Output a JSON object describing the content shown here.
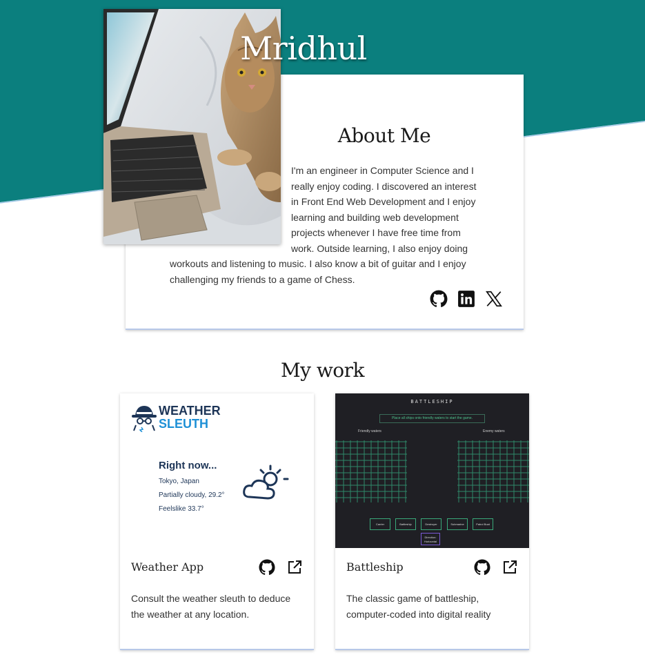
{
  "header": {
    "title": "Mridhul"
  },
  "about": {
    "heading": "About Me",
    "paragraph": "I'm an engineer in Computer Science and I really enjoy coding. I discovered an interest in Front End Web Development and I enjoy learning and building web development projects whenever I have free time from work. Outside learning, I also enjoy doing workouts and listening to music. I also know a bit of guitar and I enjoy challenging my friends to a game of Chess.",
    "social_icons": [
      "github-icon",
      "linkedin-icon",
      "x-icon"
    ]
  },
  "work": {
    "heading": "My work",
    "projects": [
      {
        "title": "Weather App",
        "description": "Consult the weather sleuth to deduce the weather at any location.",
        "preview": {
          "logo_line1": "WEATHER",
          "logo_line2": "SLEUTH",
          "right_now": "Right now...",
          "location": "Tokyo, Japan",
          "condition": "Partially cloudy, 29.2°",
          "feelslike": "Feelslike 33.7°"
        }
      },
      {
        "title": "Battleship",
        "description": "The classic game of battleship, computer-coded into digital reality",
        "preview": {
          "game_title": "BATTLESHIP",
          "message": "Place all ships onto friendly waters to start the game.",
          "friendly_label": "Friendly waters",
          "enemy_label": "Enemy waters",
          "ships": [
            "Carrier",
            "Battleship",
            "Destroyer",
            "Submarine",
            "Patrol Boat"
          ],
          "direction_line1": "Direction:",
          "direction_line2": "Horizontal"
        }
      }
    ]
  },
  "colors": {
    "teal": "#0b7f7e",
    "accent_border": "#b7c8e8"
  }
}
